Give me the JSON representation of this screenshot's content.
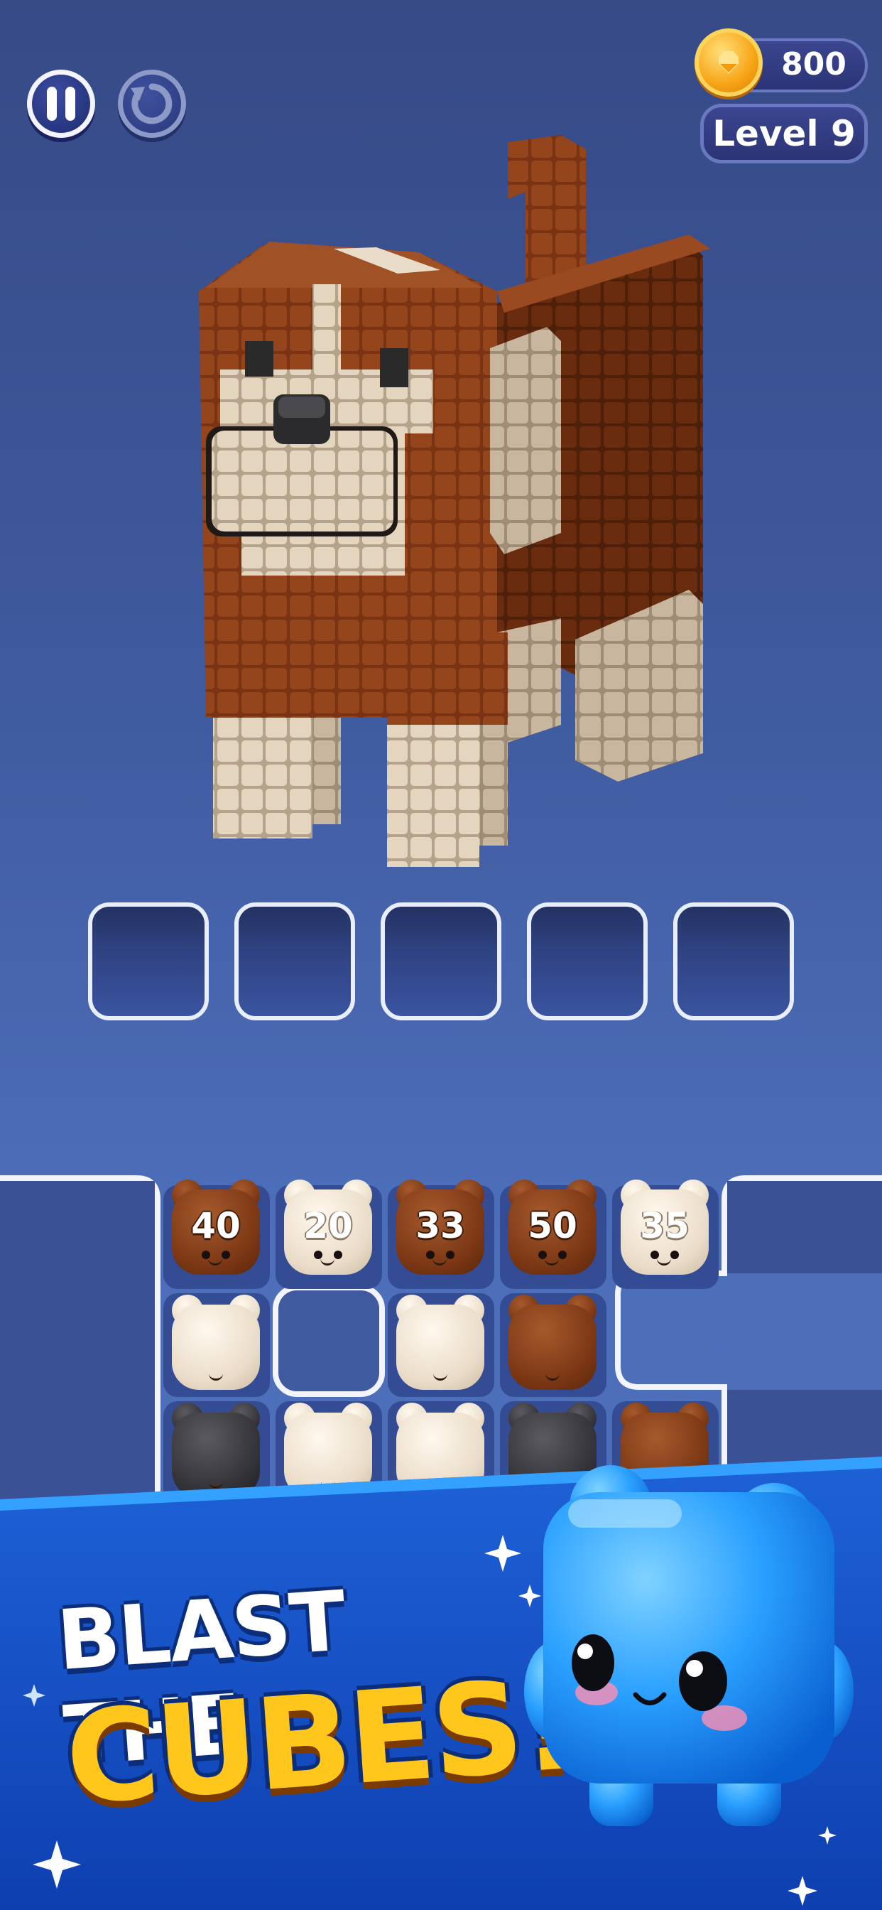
{
  "hud": {
    "coins": "800",
    "level": "Level 9",
    "pause_icon": "pause-icon",
    "restart_icon": "restart-icon",
    "coin_icon": "coin-icon"
  },
  "slots": [
    "",
    "",
    "",
    "",
    ""
  ],
  "board": {
    "row1": [
      {
        "color": "brown",
        "count": "40"
      },
      {
        "color": "cream",
        "count": "20"
      },
      {
        "color": "brown",
        "count": "33"
      },
      {
        "color": "brown",
        "count": "50"
      },
      {
        "color": "cream",
        "count": "35"
      }
    ],
    "row2": [
      "cream",
      "empty",
      "cream",
      "brown",
      "empty"
    ],
    "row3": [
      "dark",
      "cream",
      "cream",
      "dark",
      "brown"
    ]
  },
  "banner": {
    "line1": "BLAST THE",
    "line2": "CUBES!",
    "colors": {
      "banner_blue": "#1d5fd6",
      "title_white": "#ffffff",
      "title_yellow": "#ffc61c",
      "mascot": "#2aa6ff"
    }
  },
  "colors": {
    "background_top": "#364a86",
    "background_bottom": "#4c6db6",
    "brown_block": "#7b3714",
    "cream_block": "#eadcc8",
    "dark_block": "#333338"
  }
}
